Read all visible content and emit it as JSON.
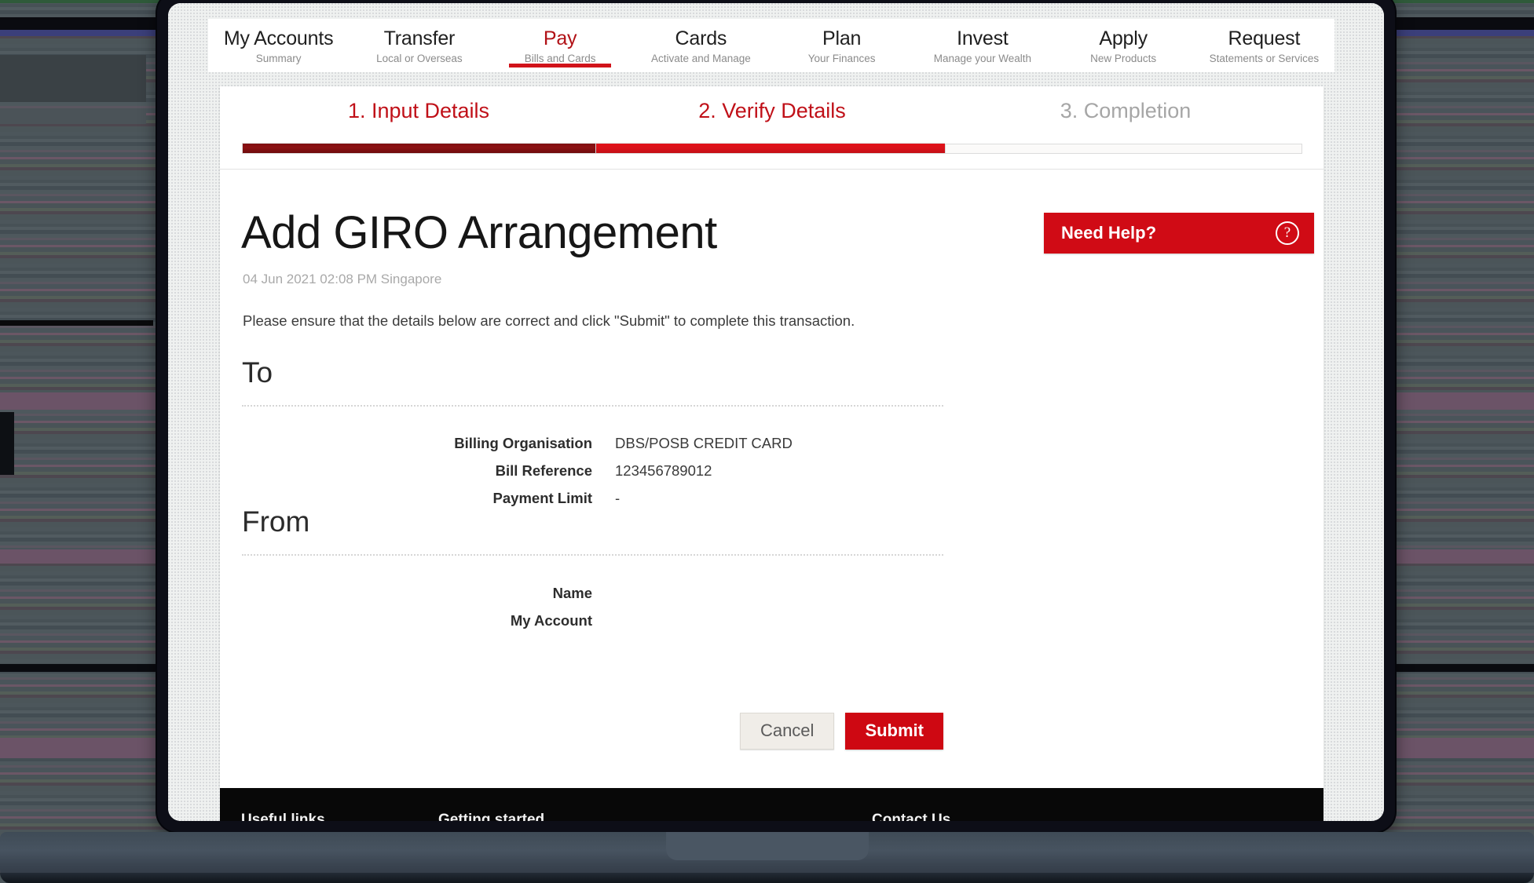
{
  "nav": {
    "items": [
      {
        "title": "My Accounts",
        "sub": "Summary",
        "active": false
      },
      {
        "title": "Transfer",
        "sub": "Local or Overseas",
        "active": false
      },
      {
        "title": "Pay",
        "sub": "Bills and Cards",
        "active": true
      },
      {
        "title": "Cards",
        "sub": "Activate and Manage",
        "active": false
      },
      {
        "title": "Plan",
        "sub": "Your Finances",
        "active": false
      },
      {
        "title": "Invest",
        "sub": "Manage your Wealth",
        "active": false
      },
      {
        "title": "Apply",
        "sub": "New Products",
        "active": false
      },
      {
        "title": "Request",
        "sub": "Statements or Services",
        "active": false
      }
    ]
  },
  "stepper": {
    "steps": [
      {
        "label": "1. Input Details",
        "state": "done"
      },
      {
        "label": "2. Verify Details",
        "state": "current"
      },
      {
        "label": "3. Completion",
        "state": "todo"
      }
    ]
  },
  "main": {
    "title": "Add GIRO Arrangement",
    "timestamp": "04 Jun 2021 02:08 PM Singapore",
    "instruction": "Please ensure that the details below are correct and click \"Submit\" to complete this transaction.",
    "need_help": {
      "label": "Need Help?",
      "icon": "question-circle-icon"
    },
    "sections": [
      {
        "heading": "To",
        "fields": [
          {
            "label": "Billing Organisation",
            "value": "DBS/POSB CREDIT CARD"
          },
          {
            "label": "Bill Reference",
            "value": "123456789012"
          },
          {
            "label": "Payment Limit",
            "value": "-"
          }
        ]
      },
      {
        "heading": "From",
        "fields": [
          {
            "label": "Name",
            "value": ""
          },
          {
            "label": "My Account",
            "value": ""
          }
        ]
      }
    ],
    "buttons": {
      "cancel": "Cancel",
      "submit": "Submit"
    }
  },
  "footer": {
    "columns": [
      "Useful links",
      "Getting started",
      "Contact Us"
    ]
  },
  "colors": {
    "brand_red": "#d00b15",
    "submit_red": "#ce0812",
    "step_done": "#7e0d10",
    "step_current": "#d9121a",
    "nav_active_red": "#b11116",
    "muted_gray": "#a9a9a9"
  }
}
